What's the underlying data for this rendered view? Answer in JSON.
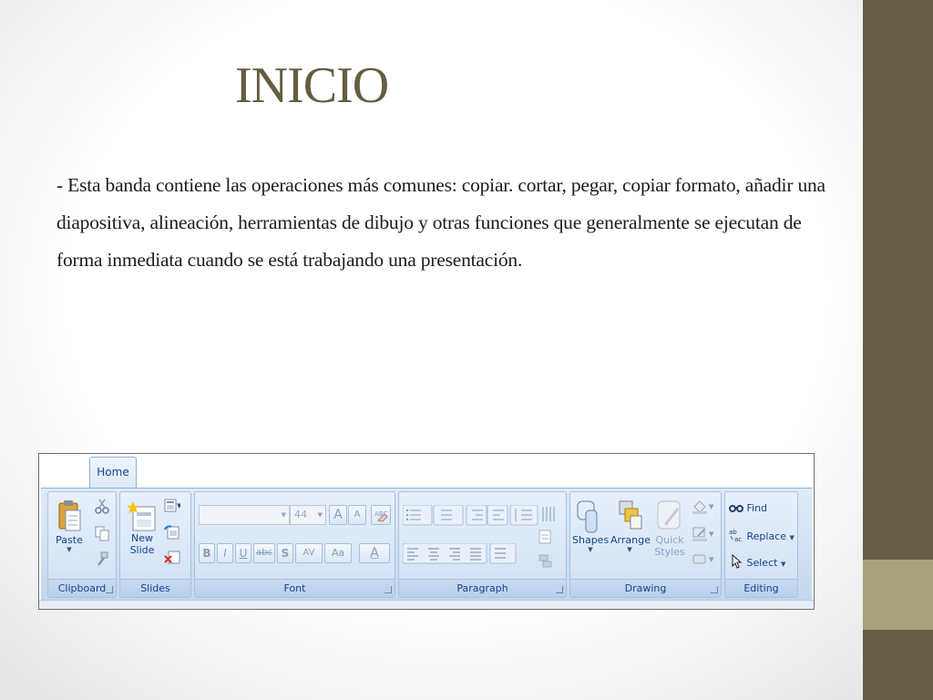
{
  "slide": {
    "title": "INICIO",
    "body": "- Esta banda contiene las operaciones más comunes: copiar. cortar, pegar, copiar formato, añadir una diapositiva, alineación, herramientas de dibujo y otras funciones que generalmente se ejecutan de forma inmediata cuando se está trabajando una presentación."
  },
  "colors": {
    "title": "#645d3f",
    "side_bar": "#655f45",
    "side_accent": "#a7a17c",
    "ribbon_text": "#15428b"
  },
  "ribbon": {
    "tab": "Home",
    "groups": {
      "clipboard": {
        "label": "Clipboard",
        "paste": "Paste",
        "icons": [
          "cut-icon",
          "copy-icon",
          "format-painter-icon"
        ]
      },
      "slides": {
        "label": "Slides",
        "new_slide_line1": "New",
        "new_slide_line2": "Slide"
      },
      "font": {
        "label": "Font",
        "font_size": "44",
        "bold": "B",
        "italic": "I",
        "underline": "U",
        "strike": "abc",
        "shadow": "S",
        "spacing": "AV",
        "change_case": "Aa",
        "grow": "A",
        "shrink": "A",
        "font_color": "A"
      },
      "paragraph": {
        "label": "Paragraph"
      },
      "drawing": {
        "label": "Drawing",
        "shapes": "Shapes",
        "arrange": "Arrange",
        "quick_styles_line1": "Quick",
        "quick_styles_line2": "Styles"
      },
      "editing": {
        "label": "Editing",
        "find": "Find",
        "replace": "Replace",
        "select": "Select"
      }
    }
  }
}
